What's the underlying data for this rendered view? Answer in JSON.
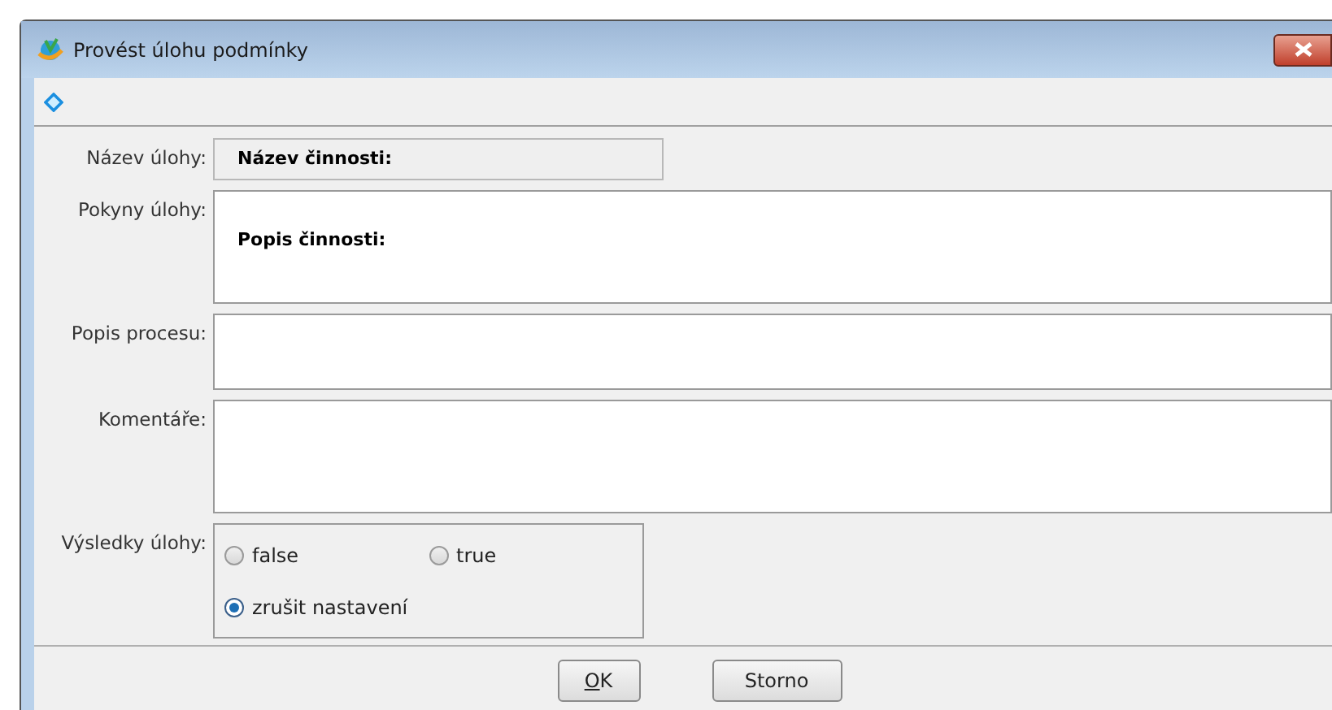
{
  "window": {
    "title": "Provést úlohu podmínky"
  },
  "fields": [
    {
      "label": "Název úlohy:",
      "kind": "readonly",
      "value": "Název činnosti:"
    },
    {
      "label": "Pokyny úlohy:",
      "kind": "textarea",
      "value": "Popis činnosti:"
    },
    {
      "label": "Popis procesu:",
      "kind": "textarea-small"
    },
    {
      "label": "Komentáře:",
      "kind": "textarea"
    }
  ],
  "results": {
    "label": "Výsledky úlohy:",
    "options": [
      {
        "label": "false",
        "selected": false
      },
      {
        "label": "true",
        "selected": false
      },
      {
        "label": "zrušit nastavení",
        "selected": true
      }
    ]
  },
  "buttons": [
    {
      "label": "OK",
      "mnemonic": true
    },
    {
      "label": "Storno",
      "mnemonic": false
    }
  ]
}
